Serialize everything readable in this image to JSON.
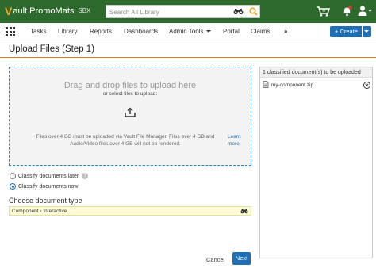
{
  "app": {
    "brand_v": "V",
    "brand_name": "ault PromoMats",
    "env_badge": "SBX"
  },
  "search": {
    "placeholder": "Search All Library",
    "value": ""
  },
  "nav": {
    "items": [
      {
        "label": "Tasks"
      },
      {
        "label": "Library"
      },
      {
        "label": "Reports"
      },
      {
        "label": "Dashboards"
      },
      {
        "label": "Admin Tools"
      },
      {
        "label": "Portal"
      },
      {
        "label": "Claims"
      }
    ],
    "more_label": "»",
    "create_label": "+ Create"
  },
  "page": {
    "title": "Upload Files (Step 1)"
  },
  "dropzone": {
    "main_text": "Drag and drop files to upload here",
    "sub_text": "or select files to upload:",
    "note": "Files over 4 GB must be uploaded via Vault File Manager. Files over 4 GB and Audio/Video files over 4 GB will not be rendered.",
    "learn_more": "Learn more."
  },
  "classify": {
    "options": [
      {
        "label": "Classify documents later",
        "checked": false
      },
      {
        "label": "Classify documents now",
        "checked": true
      }
    ],
    "help_glyph": "?"
  },
  "doc_type": {
    "label": "Choose document type",
    "value": "Component › Interactive"
  },
  "footer": {
    "cancel_label": "Cancel",
    "next_label": "Next"
  },
  "right_panel": {
    "header": "1 classified document(s) to be uploaded",
    "files": [
      {
        "name": "my-component.zip"
      }
    ]
  },
  "colors": {
    "topbar": "#2e6a2e",
    "brand_accent": "#f5a623",
    "primary": "#1f6fb5",
    "title_rule": "#e07a1f",
    "dropzone_border": "#1f88c8"
  },
  "icons": {
    "search": "search-icon",
    "binoculars": "binoculars-icon",
    "cart": "cart-icon",
    "bell": "bell-icon",
    "user": "user-icon",
    "apps": "apps-grid-icon",
    "upload": "upload-icon",
    "document": "document-icon",
    "remove": "remove-circle-icon"
  }
}
